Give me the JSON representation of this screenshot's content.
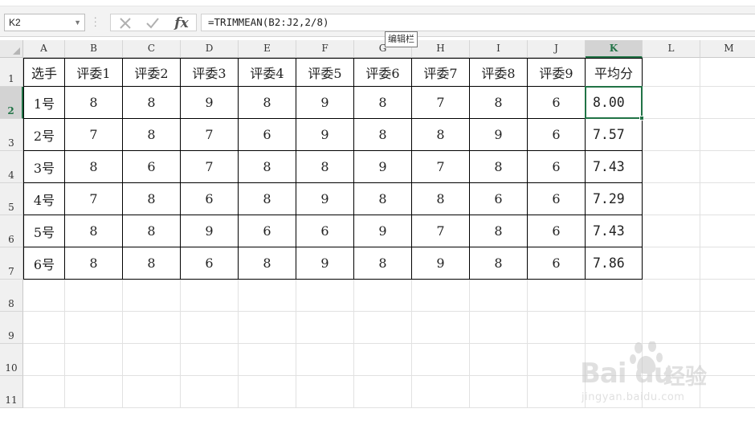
{
  "formula_bar": {
    "name_box": "K2",
    "cancel_icon": "close-icon",
    "confirm_icon": "check-icon",
    "fx_label": "fx",
    "formula": "=TRIMMEAN(B2:J2,2/8)",
    "tooltip": "编辑栏"
  },
  "columns": [
    "A",
    "B",
    "C",
    "D",
    "E",
    "F",
    "G",
    "H",
    "I",
    "J",
    "K",
    "L",
    "M"
  ],
  "rows": [
    "1",
    "2",
    "3",
    "4",
    "5",
    "6",
    "7",
    "8",
    "9",
    "10",
    "11"
  ],
  "selected_cell": "K2",
  "table": {
    "header": [
      "选手",
      "评委1",
      "评委2",
      "评委3",
      "评委4",
      "评委5",
      "评委6",
      "评委7",
      "评委8",
      "评委9",
      "平均分"
    ],
    "rows": [
      [
        "1号",
        "8",
        "8",
        "9",
        "8",
        "9",
        "8",
        "7",
        "8",
        "6",
        "8.00"
      ],
      [
        "2号",
        "7",
        "8",
        "7",
        "6",
        "9",
        "8",
        "8",
        "9",
        "6",
        "7.57"
      ],
      [
        "3号",
        "8",
        "6",
        "7",
        "8",
        "8",
        "9",
        "7",
        "8",
        "6",
        "7.43"
      ],
      [
        "4号",
        "7",
        "8",
        "6",
        "8",
        "9",
        "8",
        "8",
        "6",
        "6",
        "7.29"
      ],
      [
        "5号",
        "8",
        "8",
        "9",
        "6",
        "6",
        "9",
        "7",
        "8",
        "6",
        "7.43"
      ],
      [
        "6号",
        "8",
        "8",
        "6",
        "8",
        "9",
        "8",
        "9",
        "8",
        "6",
        "7.86"
      ]
    ]
  },
  "watermark": {
    "logo": "Bai du",
    "logo_cn": "经验",
    "url": "jingyan.baidu.com"
  },
  "colors": {
    "accent": "#217346",
    "header_bg": "#f0f0f0",
    "selected_header_bg": "#d3d3d3"
  }
}
